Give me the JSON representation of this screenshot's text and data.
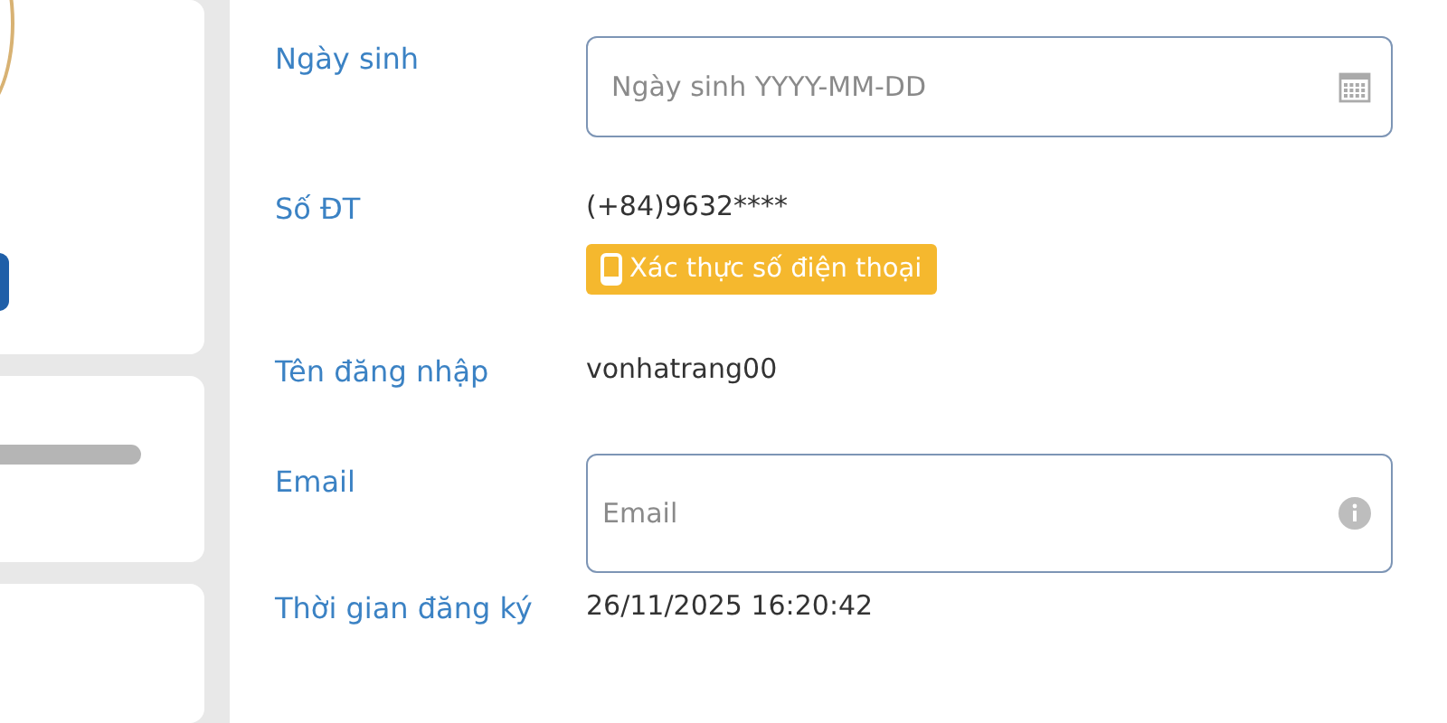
{
  "sidebar": {
    "cards": [
      {
        "kind": "profile"
      },
      {
        "kind": "progress"
      },
      {
        "kind": "empty"
      }
    ]
  },
  "form": {
    "rows": [
      {
        "kind": "date",
        "label": "Ngày sinh",
        "placeholder": "Ngày sinh YYYY-MM-DD"
      },
      {
        "kind": "phone",
        "label": "Số ĐT",
        "value": "(+84)9632****",
        "action": "Xác thực số điện thoại"
      },
      {
        "kind": "text",
        "label": "Tên đăng nhập",
        "value": "vonhatrang00"
      },
      {
        "kind": "email",
        "label": "Email",
        "placeholder": "Email"
      },
      {
        "kind": "text",
        "label": "Thời gian đăng ký",
        "value": "26/11/2025 16:20:42"
      }
    ]
  }
}
